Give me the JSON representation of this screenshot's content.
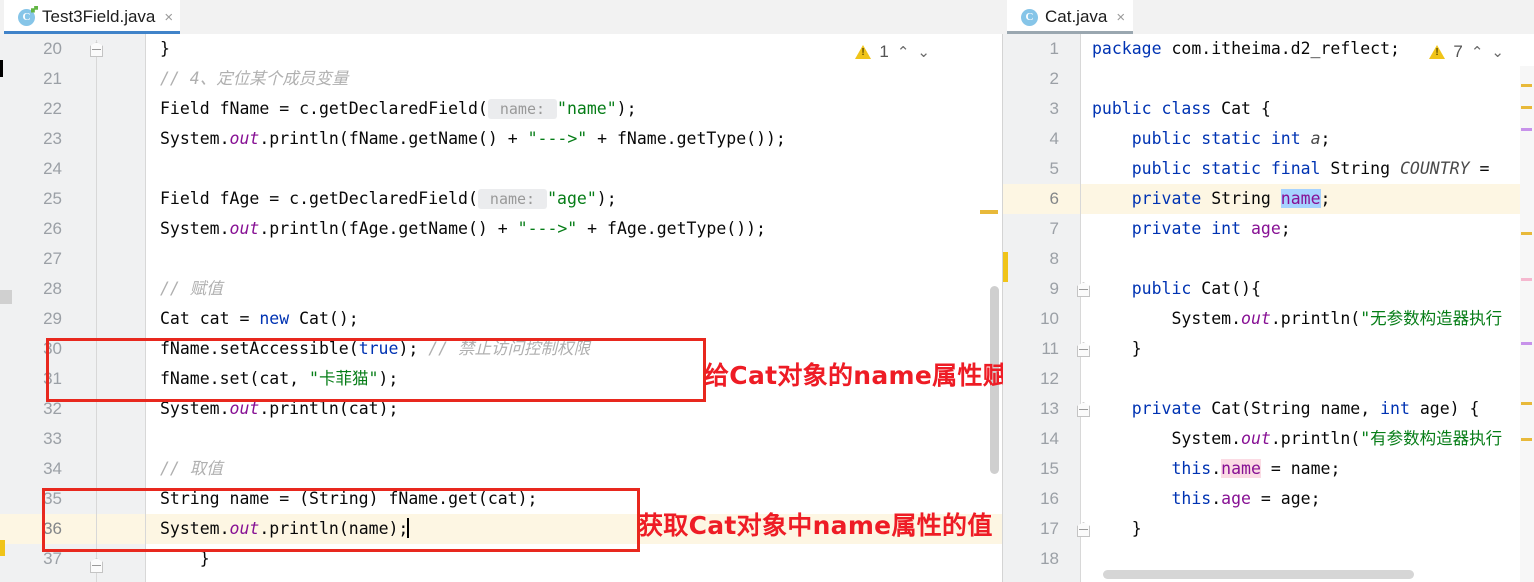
{
  "window": {
    "app": "intellij-idea-editor",
    "accent_blue": "#4083c9",
    "annotation_red": "#ee1c25",
    "current_line_bg": "#fdf6e3"
  },
  "left_pane": {
    "tab": {
      "label": "Test3Field.java",
      "icon": "java-class-icon",
      "close": "×",
      "active": true
    },
    "inspection": {
      "warning_count": "1",
      "icon": "warning-triangle-icon",
      "prev": "⌃",
      "next": "⌄"
    },
    "first_line_number": 20,
    "line_numbers": [
      20,
      21,
      22,
      23,
      24,
      25,
      26,
      27,
      28,
      29,
      30,
      31,
      32,
      33,
      34,
      35,
      36,
      37
    ],
    "current_line": 36,
    "lines": [
      {
        "n": 20,
        "tokens": [
          {
            "t": "}",
            "c": "pln"
          }
        ]
      },
      {
        "n": 21,
        "tokens": [
          {
            "t": "// 4、定位某个成员变量",
            "c": "cmt"
          }
        ]
      },
      {
        "n": 22,
        "tokens": [
          {
            "t": "Field fName = c.getDeclaredField(",
            "c": "pln"
          },
          {
            "t": " name: ",
            "c": "hint"
          },
          {
            "t": "\"name\"",
            "c": "str"
          },
          {
            "t": ");",
            "c": "pln"
          }
        ]
      },
      {
        "n": 23,
        "tokens": [
          {
            "t": "System.",
            "c": "pln"
          },
          {
            "t": "out",
            "c": "stat"
          },
          {
            "t": ".println(fName.getName() + ",
            "c": "pln"
          },
          {
            "t": "\"--->\"",
            "c": "str"
          },
          {
            "t": " + fName.getType());",
            "c": "pln"
          }
        ]
      },
      {
        "n": 24,
        "tokens": []
      },
      {
        "n": 25,
        "tokens": [
          {
            "t": "Field fAge = c.getDeclaredField(",
            "c": "pln"
          },
          {
            "t": " name: ",
            "c": "hint"
          },
          {
            "t": "\"age\"",
            "c": "str"
          },
          {
            "t": ");",
            "c": "pln"
          }
        ]
      },
      {
        "n": 26,
        "tokens": [
          {
            "t": "System.",
            "c": "pln"
          },
          {
            "t": "out",
            "c": "stat"
          },
          {
            "t": ".println(fAge.getName() + ",
            "c": "pln"
          },
          {
            "t": "\"--->\"",
            "c": "str"
          },
          {
            "t": " + fAge.getType());",
            "c": "pln"
          }
        ]
      },
      {
        "n": 27,
        "tokens": []
      },
      {
        "n": 28,
        "tokens": [
          {
            "t": "// 赋值",
            "c": "cmt"
          }
        ]
      },
      {
        "n": 29,
        "tokens": [
          {
            "t": "Cat cat = ",
            "c": "pln"
          },
          {
            "t": "new",
            "c": "kw"
          },
          {
            "t": " Cat();",
            "c": "pln"
          }
        ]
      },
      {
        "n": 30,
        "tokens": [
          {
            "t": "fName.setAccessible(",
            "c": "pln"
          },
          {
            "t": "true",
            "c": "kw"
          },
          {
            "t": "); ",
            "c": "pln"
          },
          {
            "t": "// 禁止访问控制权限",
            "c": "cmt"
          }
        ]
      },
      {
        "n": 31,
        "tokens": [
          {
            "t": "fName.set(cat, ",
            "c": "pln"
          },
          {
            "t": "\"卡菲猫\"",
            "c": "str"
          },
          {
            "t": ");",
            "c": "pln"
          }
        ]
      },
      {
        "n": 32,
        "tokens": [
          {
            "t": "System.",
            "c": "pln"
          },
          {
            "t": "out",
            "c": "stat"
          },
          {
            "t": ".println(cat);",
            "c": "pln"
          }
        ]
      },
      {
        "n": 33,
        "tokens": []
      },
      {
        "n": 34,
        "tokens": [
          {
            "t": "// 取值",
            "c": "cmt"
          }
        ]
      },
      {
        "n": 35,
        "tokens": [
          {
            "t": "String name = (String) fName.get(cat);",
            "c": "pln"
          }
        ]
      },
      {
        "n": 36,
        "tokens": [
          {
            "t": "System.",
            "c": "pln"
          },
          {
            "t": "out",
            "c": "stat"
          },
          {
            "t": ".println(name);",
            "c": "pln"
          },
          {
            "t": "",
            "c": "caret"
          }
        ]
      },
      {
        "n": 37,
        "tokens": [
          {
            "t": "    }",
            "c": "pln"
          }
        ]
      }
    ],
    "annotations": [
      {
        "name": "annotation-set-name",
        "text": "给Cat对象的name属性赋值"
      },
      {
        "name": "annotation-get-name",
        "text": "获取Cat对象中name属性的值"
      }
    ]
  },
  "right_pane": {
    "tab": {
      "label": "Cat.java",
      "icon": "java-class-icon",
      "close": "×",
      "active": false
    },
    "inspection": {
      "warning_count": "7",
      "icon": "warning-triangle-icon",
      "prev": "⌃",
      "next": "⌄"
    },
    "line_numbers": [
      1,
      2,
      3,
      4,
      5,
      6,
      7,
      8,
      9,
      10,
      11,
      12,
      13,
      14,
      15,
      16,
      17,
      18
    ],
    "current_line": 6,
    "lines": [
      {
        "n": 1,
        "tokens": [
          {
            "t": "package",
            "c": "kw"
          },
          {
            "t": " com.itheima.d2_reflect;",
            "c": "pln"
          }
        ]
      },
      {
        "n": 2,
        "tokens": []
      },
      {
        "n": 3,
        "tokens": [
          {
            "t": "public class",
            "c": "kw"
          },
          {
            "t": " Cat {",
            "c": "pln"
          }
        ]
      },
      {
        "n": 4,
        "tokens": [
          {
            "t": "    ",
            "c": "pln"
          },
          {
            "t": "public static int",
            "c": "kw"
          },
          {
            "t": " ",
            "c": "pln"
          },
          {
            "t": "a",
            "c": "cstf"
          },
          {
            "t": ";",
            "c": "pln"
          }
        ]
      },
      {
        "n": 5,
        "tokens": [
          {
            "t": "    ",
            "c": "pln"
          },
          {
            "t": "public static final",
            "c": "kw"
          },
          {
            "t": " String ",
            "c": "pln"
          },
          {
            "t": "COUNTRY",
            "c": "cstf"
          },
          {
            "t": " =",
            "c": "pln"
          }
        ]
      },
      {
        "n": 6,
        "tokens": [
          {
            "t": "    ",
            "c": "pln"
          },
          {
            "t": "private",
            "c": "kw"
          },
          {
            "t": " String ",
            "c": "pln"
          },
          {
            "t": "name",
            "c": "fld sel-blue"
          },
          {
            "t": ";",
            "c": "pln"
          }
        ]
      },
      {
        "n": 7,
        "tokens": [
          {
            "t": "    ",
            "c": "pln"
          },
          {
            "t": "private int",
            "c": "kw"
          },
          {
            "t": " ",
            "c": "pln"
          },
          {
            "t": "age",
            "c": "fld"
          },
          {
            "t": ";",
            "c": "pln"
          }
        ]
      },
      {
        "n": 8,
        "tokens": []
      },
      {
        "n": 9,
        "tokens": [
          {
            "t": "    ",
            "c": "pln"
          },
          {
            "t": "public",
            "c": "kw"
          },
          {
            "t": " Cat(){",
            "c": "pln"
          }
        ]
      },
      {
        "n": 10,
        "tokens": [
          {
            "t": "        System.",
            "c": "pln"
          },
          {
            "t": "out",
            "c": "stat"
          },
          {
            "t": ".println(",
            "c": "pln"
          },
          {
            "t": "\"无参数构造器执行",
            "c": "str"
          }
        ]
      },
      {
        "n": 11,
        "tokens": [
          {
            "t": "    }",
            "c": "pln"
          }
        ]
      },
      {
        "n": 12,
        "tokens": []
      },
      {
        "n": 13,
        "tokens": [
          {
            "t": "    ",
            "c": "pln"
          },
          {
            "t": "private",
            "c": "kw"
          },
          {
            "t": " Cat(String name, ",
            "c": "pln"
          },
          {
            "t": "int",
            "c": "kw"
          },
          {
            "t": " age) {",
            "c": "pln"
          }
        ]
      },
      {
        "n": 14,
        "tokens": [
          {
            "t": "        System.",
            "c": "pln"
          },
          {
            "t": "out",
            "c": "stat"
          },
          {
            "t": ".println(",
            "c": "pln"
          },
          {
            "t": "\"有参数构造器执行",
            "c": "str"
          }
        ]
      },
      {
        "n": 15,
        "tokens": [
          {
            "t": "        ",
            "c": "pln"
          },
          {
            "t": "this",
            "c": "kw"
          },
          {
            "t": ".",
            "c": "pln"
          },
          {
            "t": "name",
            "c": "fld sel-pink"
          },
          {
            "t": " = name;",
            "c": "pln"
          }
        ]
      },
      {
        "n": 16,
        "tokens": [
          {
            "t": "        ",
            "c": "pln"
          },
          {
            "t": "this",
            "c": "kw"
          },
          {
            "t": ".",
            "c": "pln"
          },
          {
            "t": "age",
            "c": "fld"
          },
          {
            "t": " = age;",
            "c": "pln"
          }
        ]
      },
      {
        "n": 17,
        "tokens": [
          {
            "t": "    }",
            "c": "pln"
          }
        ]
      },
      {
        "n": 18,
        "tokens": []
      }
    ]
  }
}
